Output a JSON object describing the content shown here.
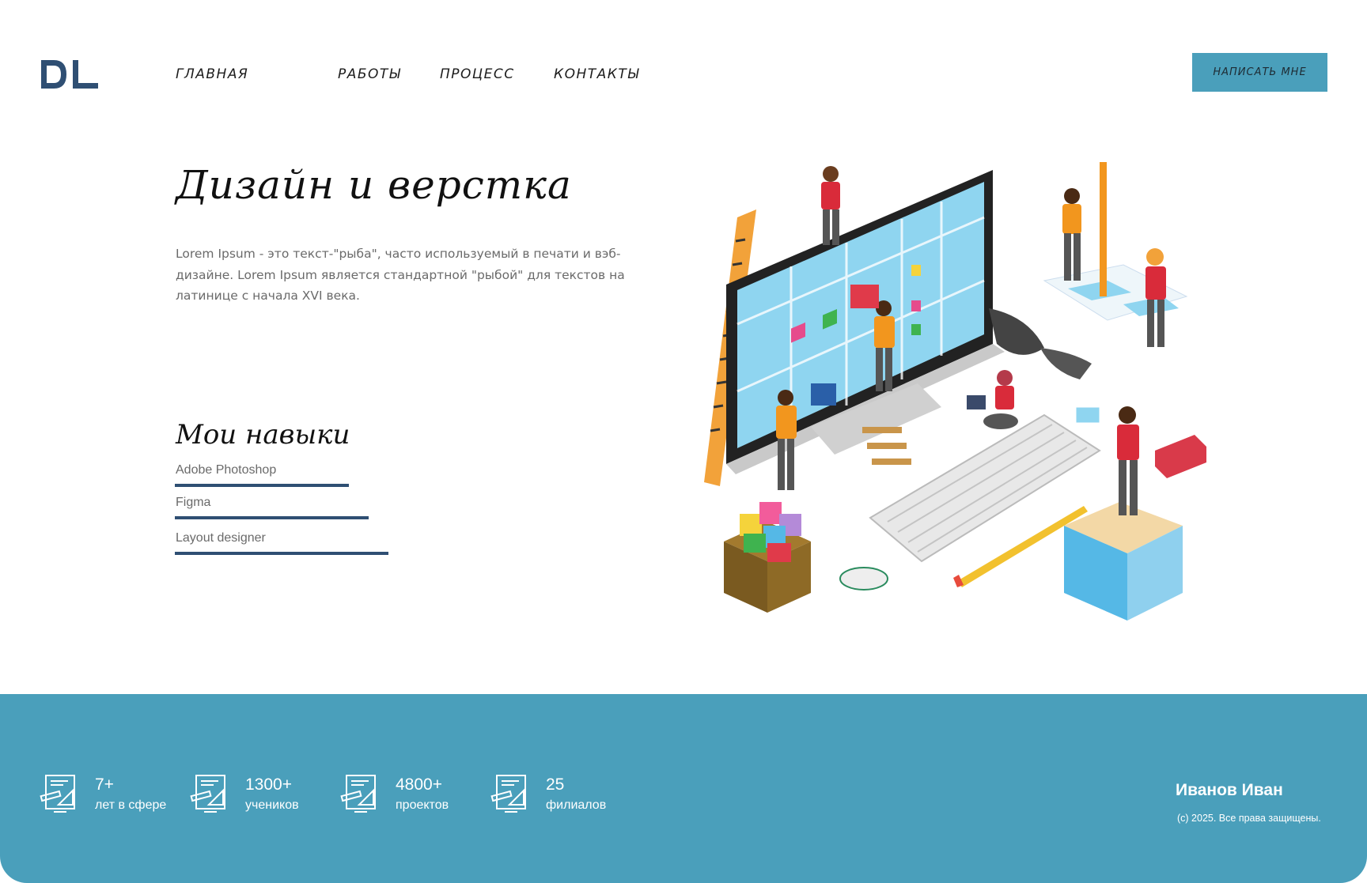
{
  "header": {
    "logo_text": "DL",
    "nav": [
      {
        "label": "ГЛАВНАЯ"
      },
      {
        "label": "РАБОТЫ"
      },
      {
        "label": "ПРОЦЕСС"
      },
      {
        "label": "КОНТАКТЫ"
      }
    ],
    "cta_label": "НАПИСАТЬ МНЕ"
  },
  "hero": {
    "title": "Дизайн и верстка",
    "text": "Lorem Ipsum - это текст-\"рыба\", часто используемый в печати и вэб-дизайне. Lorem Ipsum является стандартной \"рыбой\" для текстов на латинице с начала XVI века."
  },
  "skills": {
    "title": "Мои навыки",
    "items": [
      {
        "label": "Adobe Photoshop"
      },
      {
        "label": "Figma"
      },
      {
        "label": "Layout designer"
      }
    ]
  },
  "footer": {
    "stats": [
      {
        "value": "7+",
        "label": "лет в сфере",
        "icon": "drafting-tools-icon"
      },
      {
        "value": "1300+",
        "label": "учеников",
        "icon": "drafting-tools-icon"
      },
      {
        "value": "4800+",
        "label": "проектов",
        "icon": "drafting-tools-icon"
      },
      {
        "value": "25",
        "label": "филиалов",
        "icon": "drafting-tools-icon"
      }
    ],
    "author": "Иванов Иван",
    "copyright": "(c) 2025. Все права защищены."
  },
  "colors": {
    "accent": "#4a9fbb",
    "logo": "#2f4f73",
    "skill_bar": "#2f4f73",
    "text_muted": "#6a6a6a"
  }
}
